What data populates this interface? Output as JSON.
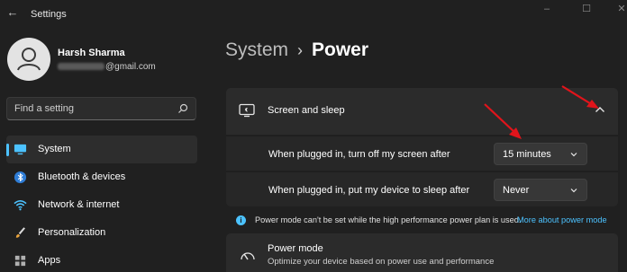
{
  "window": {
    "title": "Settings",
    "back_icon": "back-arrow-icon",
    "controls": [
      "minimize",
      "maximize",
      "close"
    ]
  },
  "user": {
    "name": "Harsh Sharma",
    "email_visible": "@gmail.com"
  },
  "search": {
    "placeholder": "Find a setting",
    "icon": "search-icon"
  },
  "sidebar": {
    "items": [
      {
        "label": "System",
        "icon": "monitor-icon",
        "selected": true
      },
      {
        "label": "Bluetooth & devices",
        "icon": "bluetooth-icon",
        "selected": false
      },
      {
        "label": "Network & internet",
        "icon": "wifi-icon",
        "selected": false
      },
      {
        "label": "Personalization",
        "icon": "brush-icon",
        "selected": false
      },
      {
        "label": "Apps",
        "icon": "apps-icon",
        "selected": false
      }
    ]
  },
  "breadcrumb": {
    "parent": "System",
    "separator": "›",
    "current": "Power"
  },
  "screen_sleep": {
    "title": "Screen and sleep",
    "expanded": true,
    "rows": [
      {
        "label": "When plugged in, turn off my screen after",
        "value": "15 minutes"
      },
      {
        "label": "When plugged in, put my device to sleep after",
        "value": "Never"
      }
    ]
  },
  "info": {
    "text": "Power mode can't be set while the high performance power plan is used.",
    "link": "More about power mode"
  },
  "power_mode": {
    "title": "Power mode",
    "description": "Optimize your device based on power use and performance"
  },
  "colors": {
    "accent": "#4cc2ff",
    "annotation_arrow": "#e0141b",
    "background": "#202020",
    "card": "#2b2b2b"
  }
}
